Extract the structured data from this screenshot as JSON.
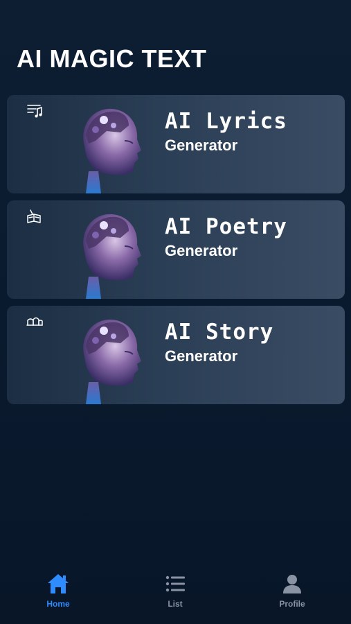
{
  "header": {
    "title": "AI MAGIC TEXT"
  },
  "cards": [
    {
      "title": "AI Lyrics",
      "subtitle": "Generator",
      "icon": "music-notes-icon"
    },
    {
      "title": "AI Poetry",
      "subtitle": "Generator",
      "icon": "book-quill-icon"
    },
    {
      "title": "AI Story",
      "subtitle": "Generator",
      "icon": "castle-icon"
    }
  ],
  "tabbar": {
    "home_label": "Home",
    "list_label": "List",
    "profile_label": "Profile",
    "active": "Home"
  },
  "colors": {
    "background": "#0b1a2e",
    "card": "#2a3e55",
    "accent": "#2f8cff",
    "inactive": "#8a93a3"
  }
}
